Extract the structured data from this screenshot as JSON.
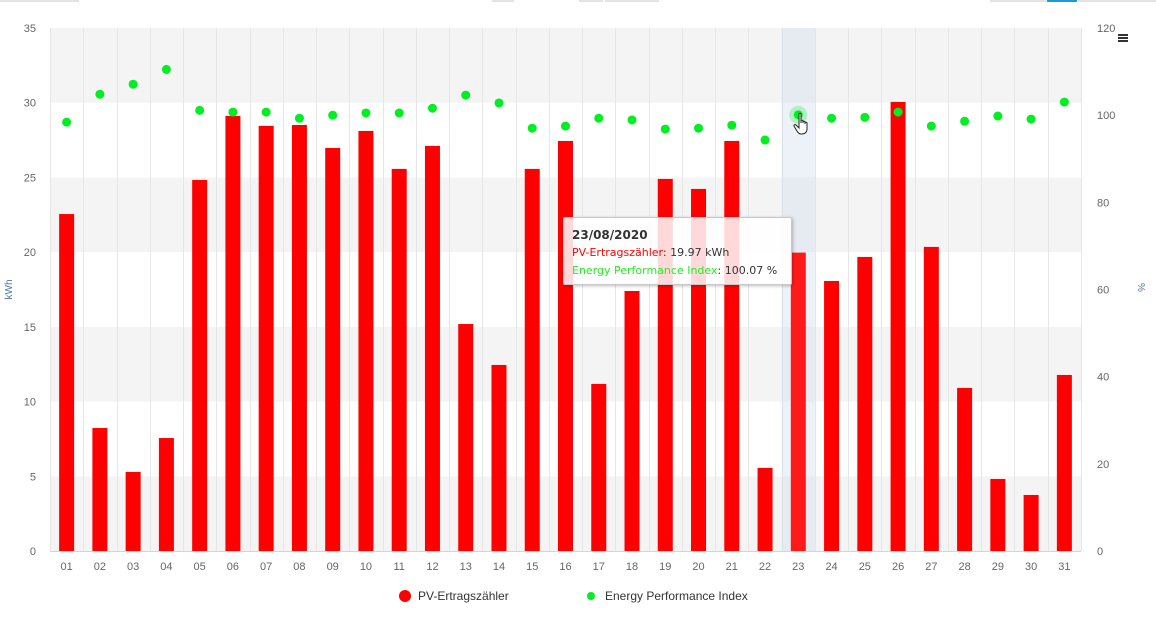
{
  "top_controls": [
    "ctrl-1",
    "ctrl-2",
    "ctrl-3",
    "ctrl-4",
    "ctrl-5",
    "ctrl-6-active",
    "ctrl-7"
  ],
  "menu": {
    "icon": "hamburger-menu-icon"
  },
  "tooltip": {
    "date": "23/08/2020",
    "series1_label": "PV-Ertragszähler",
    "series1_value": ": 19.97 kWh",
    "series2_label": "Energy Performance Index",
    "series2_value": ": 100.07 %"
  },
  "chart_data": {
    "type": "bar",
    "title": "",
    "categories": [
      "01",
      "02",
      "03",
      "04",
      "05",
      "06",
      "07",
      "08",
      "09",
      "10",
      "11",
      "12",
      "13",
      "14",
      "15",
      "16",
      "17",
      "18",
      "19",
      "20",
      "21",
      "22",
      "23",
      "24",
      "25",
      "26",
      "27",
      "28",
      "29",
      "30",
      "31"
    ],
    "highlighted_category": "23",
    "series": [
      {
        "name": "PV-Ertragszähler",
        "type": "bar",
        "axis": "left",
        "unit": "kWh",
        "color": "#ff0000",
        "values": [
          22.55,
          8.23,
          5.29,
          7.56,
          24.83,
          29.12,
          28.45,
          28.51,
          26.97,
          28.11,
          25.57,
          27.11,
          15.19,
          12.45,
          25.57,
          27.44,
          11.18,
          17.4,
          24.9,
          24.23,
          27.44,
          5.56,
          19.97,
          18.07,
          19.68,
          30.05,
          20.35,
          10.91,
          4.82,
          3.75,
          11.78
        ]
      },
      {
        "name": "Energy Performance Index",
        "type": "scatter",
        "axis": "right",
        "unit": "%",
        "color": "#00ee22",
        "values": [
          98.4,
          104.8,
          107.1,
          110.5,
          101.1,
          100.7,
          100.7,
          99.3,
          100.0,
          100.5,
          100.5,
          101.6,
          104.6,
          102.8,
          97.0,
          97.5,
          99.3,
          98.9,
          96.8,
          97.0,
          97.7,
          94.3,
          100.07,
          99.3,
          99.5,
          100.7,
          97.5,
          98.6,
          99.8,
          99.1,
          103.0
        ]
      }
    ],
    "y_left": {
      "label": "kWh",
      "min": 0,
      "max": 35,
      "ticks": [
        0,
        5,
        10,
        15,
        20,
        25,
        30,
        35
      ]
    },
    "y_right": {
      "label": "%",
      "min": 0,
      "max": 120,
      "ticks": [
        0,
        20,
        40,
        60,
        80,
        100,
        120
      ]
    },
    "xlabel": "",
    "grid": true,
    "alternate_bands": true,
    "legend_position": "bottom-center",
    "legend": [
      "PV-Ertragszähler",
      "Energy Performance Index"
    ]
  }
}
